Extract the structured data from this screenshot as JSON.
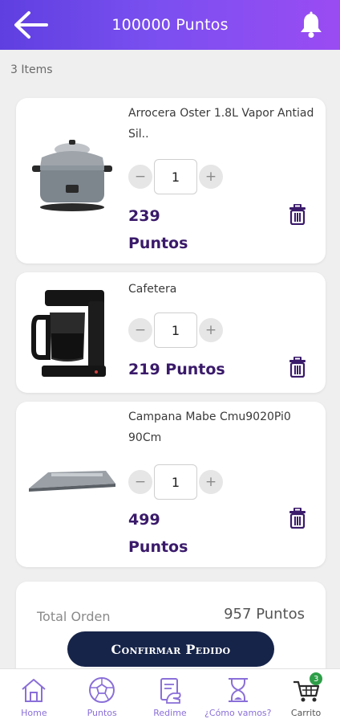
{
  "header": {
    "title": "100000 Puntos",
    "back_icon": "arrow-left-icon",
    "bell_icon": "bell-icon",
    "gradient": [
      "#5f3fe0",
      "#9a4cf2"
    ]
  },
  "items_count": "3 Items",
  "cart_items": [
    {
      "name": "Arrocera Oster 1.8L Vapor Antiad Sil..",
      "quantity": "1",
      "price": "239",
      "price_unit": "Puntos",
      "image": "rice-cooker-image"
    },
    {
      "name": "Cafetera",
      "quantity": "1",
      "price": "219 Puntos",
      "image": "coffee-maker-image"
    },
    {
      "name": "Campana Mabe Cmu9020Pi0 90Cm",
      "quantity": "1",
      "price": "499",
      "price_unit": "Puntos",
      "image": "range-hood-image"
    }
  ],
  "stepper": {
    "minus": "−",
    "plus": "+"
  },
  "total": {
    "label": "Total Orden",
    "value": "957 Puntos"
  },
  "confirm_label": "Confirmar Pedido",
  "nav": [
    {
      "label": "Home",
      "icon": "home-icon"
    },
    {
      "label": "Puntos",
      "icon": "ball-icon"
    },
    {
      "label": "Redime",
      "icon": "redeem-icon"
    },
    {
      "label": "¿Cómo vamos?",
      "icon": "progress-icon"
    },
    {
      "label": "Carrito",
      "icon": "cart-icon",
      "badge": "3",
      "active": true
    }
  ],
  "colors": {
    "accent": "#3a1a6a",
    "button": "#17244a",
    "nav_label": "#8a6fd8",
    "badge": "#2e9e48"
  }
}
